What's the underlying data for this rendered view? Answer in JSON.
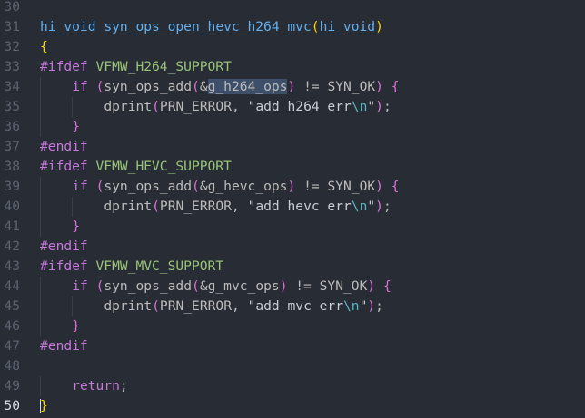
{
  "editor": {
    "lines": [
      {
        "num": "30",
        "tokens": []
      },
      {
        "num": "31",
        "tokens": [
          {
            "t": "hi_void",
            "c": "kw-type"
          },
          {
            "t": " ",
            "c": "plain"
          },
          {
            "t": "syn_ops_open_hevc_h264_mvc",
            "c": "fn"
          },
          {
            "t": "(",
            "c": "brace"
          },
          {
            "t": "hi_void",
            "c": "kw-type"
          },
          {
            "t": ")",
            "c": "brace"
          }
        ]
      },
      {
        "num": "32",
        "tokens": [
          {
            "t": "{",
            "c": "brace"
          }
        ]
      },
      {
        "num": "33",
        "tokens": [
          {
            "t": "#ifdef",
            "c": "pre-kw"
          },
          {
            "t": " ",
            "c": "plain"
          },
          {
            "t": "VFMW_H264_SUPPORT",
            "c": "macro"
          }
        ]
      },
      {
        "num": "34",
        "indent": 1,
        "tokens": [
          {
            "t": "if",
            "c": "kw"
          },
          {
            "t": " ",
            "c": "plain"
          },
          {
            "t": "(",
            "c": "paren"
          },
          {
            "t": "syn_ops_add",
            "c": "plain"
          },
          {
            "t": "(",
            "c": "paren"
          },
          {
            "t": "&",
            "c": "op"
          },
          {
            "t": "g_h264_ops",
            "c": "plain sel"
          },
          {
            "t": ")",
            "c": "paren"
          },
          {
            "t": " != ",
            "c": "op"
          },
          {
            "t": "SYN_OK",
            "c": "plain"
          },
          {
            "t": ")",
            "c": "paren"
          },
          {
            "t": " ",
            "c": "plain"
          },
          {
            "t": "{",
            "c": "paren"
          }
        ]
      },
      {
        "num": "35",
        "indent": 2,
        "tokens": [
          {
            "t": "dprint",
            "c": "plain"
          },
          {
            "t": "(",
            "c": "paren"
          },
          {
            "t": "PRN_ERROR",
            "c": "plain"
          },
          {
            "t": ", ",
            "c": "op"
          },
          {
            "t": "\"add h264 err",
            "c": "str"
          },
          {
            "t": "\\n",
            "c": "esc"
          },
          {
            "t": "\"",
            "c": "str"
          },
          {
            "t": ")",
            "c": "paren"
          },
          {
            "t": ";",
            "c": "op"
          }
        ]
      },
      {
        "num": "36",
        "indent": 1,
        "tokens": [
          {
            "t": "}",
            "c": "paren"
          }
        ]
      },
      {
        "num": "37",
        "tokens": [
          {
            "t": "#endif",
            "c": "pre-kw"
          }
        ]
      },
      {
        "num": "38",
        "tokens": [
          {
            "t": "#ifdef",
            "c": "pre-kw"
          },
          {
            "t": " ",
            "c": "plain"
          },
          {
            "t": "VFMW_HEVC_SUPPORT",
            "c": "macro"
          }
        ]
      },
      {
        "num": "39",
        "indent": 1,
        "tokens": [
          {
            "t": "if",
            "c": "kw"
          },
          {
            "t": " ",
            "c": "plain"
          },
          {
            "t": "(",
            "c": "paren"
          },
          {
            "t": "syn_ops_add",
            "c": "plain"
          },
          {
            "t": "(",
            "c": "paren"
          },
          {
            "t": "&",
            "c": "op"
          },
          {
            "t": "g_hevc_ops",
            "c": "plain"
          },
          {
            "t": ")",
            "c": "paren"
          },
          {
            "t": " != ",
            "c": "op"
          },
          {
            "t": "SYN_OK",
            "c": "plain"
          },
          {
            "t": ")",
            "c": "paren"
          },
          {
            "t": " ",
            "c": "plain"
          },
          {
            "t": "{",
            "c": "paren"
          }
        ]
      },
      {
        "num": "40",
        "indent": 2,
        "tokens": [
          {
            "t": "dprint",
            "c": "plain"
          },
          {
            "t": "(",
            "c": "paren"
          },
          {
            "t": "PRN_ERROR",
            "c": "plain"
          },
          {
            "t": ", ",
            "c": "op"
          },
          {
            "t": "\"add hevc err",
            "c": "str"
          },
          {
            "t": "\\n",
            "c": "esc"
          },
          {
            "t": "\"",
            "c": "str"
          },
          {
            "t": ")",
            "c": "paren"
          },
          {
            "t": ";",
            "c": "op"
          }
        ]
      },
      {
        "num": "41",
        "indent": 1,
        "tokens": [
          {
            "t": "}",
            "c": "paren"
          }
        ]
      },
      {
        "num": "42",
        "tokens": [
          {
            "t": "#endif",
            "c": "pre-kw"
          }
        ]
      },
      {
        "num": "43",
        "tokens": [
          {
            "t": "#ifdef",
            "c": "pre-kw"
          },
          {
            "t": " ",
            "c": "plain"
          },
          {
            "t": "VFMW_MVC_SUPPORT",
            "c": "macro"
          }
        ]
      },
      {
        "num": "44",
        "indent": 1,
        "tokens": [
          {
            "t": "if",
            "c": "kw"
          },
          {
            "t": " ",
            "c": "plain"
          },
          {
            "t": "(",
            "c": "paren"
          },
          {
            "t": "syn_ops_add",
            "c": "plain"
          },
          {
            "t": "(",
            "c": "paren"
          },
          {
            "t": "&",
            "c": "op"
          },
          {
            "t": "g_mvc_ops",
            "c": "plain"
          },
          {
            "t": ")",
            "c": "paren"
          },
          {
            "t": " != ",
            "c": "op"
          },
          {
            "t": "SYN_OK",
            "c": "plain"
          },
          {
            "t": ")",
            "c": "paren"
          },
          {
            "t": " ",
            "c": "plain"
          },
          {
            "t": "{",
            "c": "paren"
          }
        ]
      },
      {
        "num": "45",
        "indent": 2,
        "tokens": [
          {
            "t": "dprint",
            "c": "plain"
          },
          {
            "t": "(",
            "c": "paren"
          },
          {
            "t": "PRN_ERROR",
            "c": "plain"
          },
          {
            "t": ", ",
            "c": "op"
          },
          {
            "t": "\"add mvc err",
            "c": "str"
          },
          {
            "t": "\\n",
            "c": "esc"
          },
          {
            "t": "\"",
            "c": "str"
          },
          {
            "t": ")",
            "c": "paren"
          },
          {
            "t": ";",
            "c": "op"
          }
        ]
      },
      {
        "num": "46",
        "indent": 1,
        "tokens": [
          {
            "t": "}",
            "c": "paren"
          }
        ]
      },
      {
        "num": "47",
        "tokens": [
          {
            "t": "#endif",
            "c": "pre-kw"
          }
        ]
      },
      {
        "num": "48",
        "tokens": []
      },
      {
        "num": "49",
        "indent": 1,
        "tokens": [
          {
            "t": "return",
            "c": "kw"
          },
          {
            "t": ";",
            "c": "op"
          }
        ]
      },
      {
        "num": "50",
        "current": true,
        "tokens": [
          {
            "t": "}",
            "c": "brace"
          }
        ]
      }
    ]
  }
}
